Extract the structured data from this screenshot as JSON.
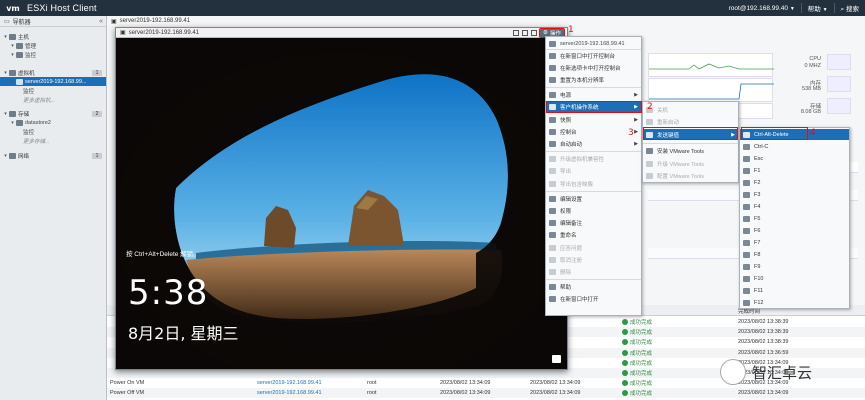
{
  "header": {
    "logo": "vm",
    "title": "ESXi Host Client",
    "user": "root@192.168.99.40",
    "help": "帮助",
    "search": "搜索"
  },
  "navigator": {
    "title": "导航器",
    "items": [
      {
        "label": "主机",
        "level": 0
      },
      {
        "label": "管理",
        "level": 1
      },
      {
        "label": "监控",
        "level": 1
      },
      {
        "label": "虚拟机",
        "level": 0,
        "count": "1"
      },
      {
        "label": "server2019-192.168.99...",
        "level": 1,
        "selected": true
      },
      {
        "label": "监控",
        "level": 2
      },
      {
        "label": "更多虚拟机...",
        "level": 2,
        "muted": true
      },
      {
        "label": "存储",
        "level": 0,
        "count": "2"
      },
      {
        "label": "datastore2",
        "level": 1
      },
      {
        "label": "监控",
        "level": 2
      },
      {
        "label": "更多存储...",
        "level": 2,
        "muted": true
      },
      {
        "label": "网络",
        "level": 0,
        "count": "1"
      }
    ]
  },
  "vm_title": "server2019-192.168.99.41",
  "right_panel": {
    "cpu_label": "CPU",
    "cpu_value": "0 MHZ",
    "mem_label": "内存",
    "mem_value": "538 MB",
    "storage_label": "存储",
    "storage_value": "8.08 GB"
  },
  "console": {
    "title": "server2019-192.168.99.41",
    "actions_label": "操作",
    "lock_hint": "按 Ctrl+Alt+Delete 解锁。",
    "time": "5:38",
    "date": "8月2日, 星期三"
  },
  "actions_menu": {
    "header": "server2019-192.168.99.41",
    "items": [
      {
        "label": "在新窗口中打开控制台"
      },
      {
        "label": "在新选项卡中打开控制台"
      },
      {
        "label": "重置为本机分辨率"
      },
      {
        "label": "电源",
        "submenu": true
      },
      {
        "label": "客户机操作系统",
        "submenu": true,
        "highlighted": true
      },
      {
        "label": "快照",
        "submenu": true
      },
      {
        "label": "控制台",
        "submenu": true
      },
      {
        "label": "自动启动",
        "submenu": true
      },
      {
        "label": "升级虚拟机兼容性",
        "disabled": true
      },
      {
        "label": "导出",
        "disabled": true
      },
      {
        "label": "导出包含映像",
        "disabled": true
      },
      {
        "label": "编辑设置"
      },
      {
        "label": "权限"
      },
      {
        "label": "编辑备注"
      },
      {
        "label": "重命名"
      },
      {
        "label": "应答问题",
        "disabled": true
      },
      {
        "label": "取消注册",
        "disabled": true
      },
      {
        "label": "删除",
        "disabled": true
      },
      {
        "label": "帮助"
      },
      {
        "label": "在新窗口中打开"
      }
    ]
  },
  "guest_os_menu": {
    "items": [
      {
        "label": "关机",
        "disabled": true
      },
      {
        "label": "重新启动",
        "disabled": true
      },
      {
        "label": "发送键值",
        "submenu": true,
        "highlighted": true
      },
      {
        "label": "安装 VMware Tools"
      },
      {
        "label": "升级 VMware Tools",
        "disabled": true
      },
      {
        "label": "配置 VMware Tools",
        "disabled": true
      }
    ]
  },
  "send_keys_menu": {
    "items": [
      "Ctrl-Alt-Delete",
      "Ctrl-C",
      "Esc",
      "F1",
      "F2",
      "F3",
      "F4",
      "F5",
      "F6",
      "F7",
      "F8",
      "F9",
      "F10",
      "F11",
      "F12"
    ]
  },
  "steps": [
    "1",
    "2",
    "3",
    "4"
  ],
  "tasks": {
    "headers": {
      "result": "结果",
      "completed": "完成时间"
    },
    "rows": [
      {
        "task": "",
        "target": "",
        "initiator": "",
        "queued": "",
        "started": "",
        "result": "成功完成",
        "completed": "2023/08/02 13:38:39"
      },
      {
        "task": "",
        "target": "",
        "initiator": "",
        "queued": "",
        "started": "",
        "result": "成功完成",
        "completed": "2023/08/02 13:38:39"
      },
      {
        "task": "",
        "target": "",
        "initiator": "",
        "queued": "",
        "started": "",
        "result": "成功完成",
        "completed": "2023/08/02 13:38:39"
      },
      {
        "task": "",
        "target": "",
        "initiator": "",
        "queued": "",
        "started": "",
        "result": "成功完成",
        "completed": "2023/08/02 13:36:59"
      },
      {
        "task": "",
        "target": "",
        "initiator": "",
        "queued": "",
        "started": "",
        "result": "成功完成",
        "completed": "2023/08/02 13:34:09"
      },
      {
        "task": "",
        "target": "",
        "initiator": "",
        "queued": "",
        "started": "",
        "result": "成功完成",
        "completed": "2023/08/02 13:34:09"
      },
      {
        "task": "Power On VM",
        "target": "server2019-192.168.99.41",
        "initiator": "root",
        "queued": "2023/08/02 13:34:09",
        "started": "2023/08/02 13:34:09",
        "result": "成功完成",
        "completed": "2023/08/02 13:34:09"
      },
      {
        "task": "Power Off VM",
        "target": "server2019-192.168.99.41",
        "initiator": "root",
        "queued": "2023/08/02 13:34:09",
        "started": "2023/08/02 13:34:09",
        "result": "成功完成",
        "completed": "2023/08/02 13:34:09"
      }
    ]
  },
  "watermark": {
    "text": "智汇卓云"
  }
}
